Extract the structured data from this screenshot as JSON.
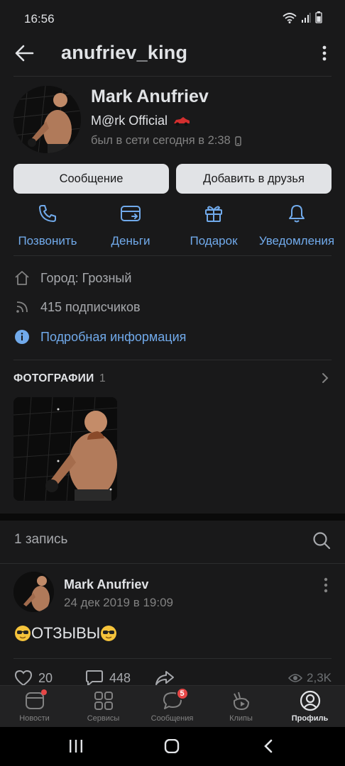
{
  "status_bar": {
    "time": "16:56"
  },
  "header": {
    "username": "anufriev_king"
  },
  "profile": {
    "name": "Mark Anufriev",
    "status": "M@rk Official",
    "online": "был в сети сегодня в 2:38"
  },
  "buttons": {
    "message": "Сообщение",
    "add_friend": "Добавить в друзья"
  },
  "actions": [
    {
      "label": "Позвонить",
      "icon": "phone-icon"
    },
    {
      "label": "Деньги",
      "icon": "money-icon"
    },
    {
      "label": "Подарок",
      "icon": "gift-icon"
    },
    {
      "label": "Уведомления",
      "icon": "bell-icon"
    }
  ],
  "info": {
    "city": "Город: Грозный",
    "followers": "415 подписчиков",
    "details_link": "Подробная информация"
  },
  "photos": {
    "title": "ФОТОГРАФИИ",
    "count": "1"
  },
  "posts": {
    "count_label": "1 запись",
    "post": {
      "author": "Mark Anufriev",
      "date": "24 дек 2019 в 19:09",
      "text": "ОТЗЫВЫ",
      "likes": "20",
      "comments": "448",
      "views": "2,3K"
    }
  },
  "tabbar": {
    "tabs": [
      {
        "label": "Новости"
      },
      {
        "label": "Сервисы"
      },
      {
        "label": "Сообщения",
        "badge": "5"
      },
      {
        "label": "Клипы"
      },
      {
        "label": "Профиль"
      }
    ]
  },
  "colors": {
    "accent": "#71aaeb",
    "background": "#19191a",
    "badge": "#e64646"
  }
}
